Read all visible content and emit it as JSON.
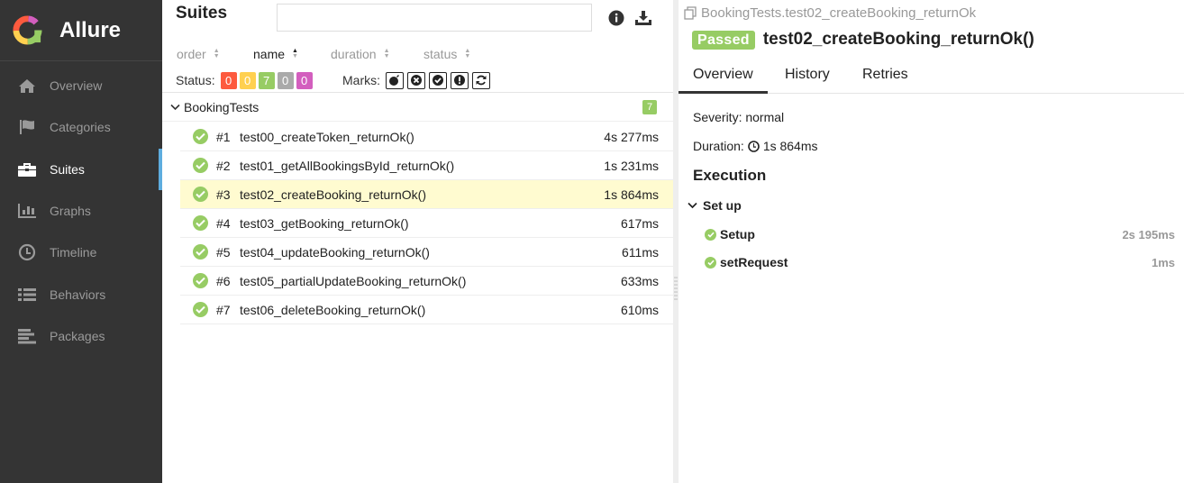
{
  "app": {
    "name": "Allure"
  },
  "sidebar": {
    "items": [
      {
        "label": "Overview",
        "icon": "home-icon"
      },
      {
        "label": "Categories",
        "icon": "flag-icon"
      },
      {
        "label": "Suites",
        "icon": "briefcase-icon",
        "active": true
      },
      {
        "label": "Graphs",
        "icon": "bar-chart-icon"
      },
      {
        "label": "Timeline",
        "icon": "clock-icon"
      },
      {
        "label": "Behaviors",
        "icon": "list-icon"
      },
      {
        "label": "Packages",
        "icon": "align-left-icon"
      }
    ]
  },
  "suites": {
    "title": "Suites",
    "search_value": "",
    "sort": {
      "order": "order",
      "name": "name",
      "duration": "duration",
      "status": "status"
    },
    "status_label": "Status:",
    "status_counts": [
      {
        "value": "0",
        "color": "#fd5a3e"
      },
      {
        "value": "0",
        "color": "#ffd050"
      },
      {
        "value": "7",
        "color": "#97cc64"
      },
      {
        "value": "0",
        "color": "#aaaaaa"
      },
      {
        "value": "0",
        "color": "#d35ebe"
      }
    ],
    "marks_label": "Marks:",
    "group": {
      "name": "BookingTests",
      "count": "7"
    },
    "tests": [
      {
        "num": "#1",
        "name": "test00_createToken_returnOk()",
        "duration": "4s 277ms"
      },
      {
        "num": "#2",
        "name": "test01_getAllBookingsById_returnOk()",
        "duration": "1s 231ms"
      },
      {
        "num": "#3",
        "name": "test02_createBooking_returnOk()",
        "duration": "1s 864ms",
        "selected": true
      },
      {
        "num": "#4",
        "name": "test03_getBooking_returnOk()",
        "duration": "617ms"
      },
      {
        "num": "#5",
        "name": "test04_updateBooking_returnOk()",
        "duration": "611ms"
      },
      {
        "num": "#6",
        "name": "test05_partialUpdateBooking_returnOk()",
        "duration": "633ms"
      },
      {
        "num": "#7",
        "name": "test06_deleteBooking_returnOk()",
        "duration": "610ms"
      }
    ]
  },
  "details": {
    "breadcrumb": "BookingTests.test02_createBooking_returnOk",
    "status": "Passed",
    "title": "test02_createBooking_returnOk()",
    "tabs": [
      "Overview",
      "History",
      "Retries"
    ],
    "severity": "Severity: normal",
    "duration_label": "Duration:",
    "duration_value": "1s 864ms",
    "execution_title": "Execution",
    "setup_label": "Set up",
    "steps": [
      {
        "name": "Setup",
        "duration": "2s 195ms"
      },
      {
        "name": "setRequest",
        "duration": "1ms"
      }
    ]
  },
  "colors": {
    "sidebar_bg": "#343434",
    "accent": "#5eaddf",
    "passed": "#97cc64",
    "selected_row": "#fffbd0"
  }
}
